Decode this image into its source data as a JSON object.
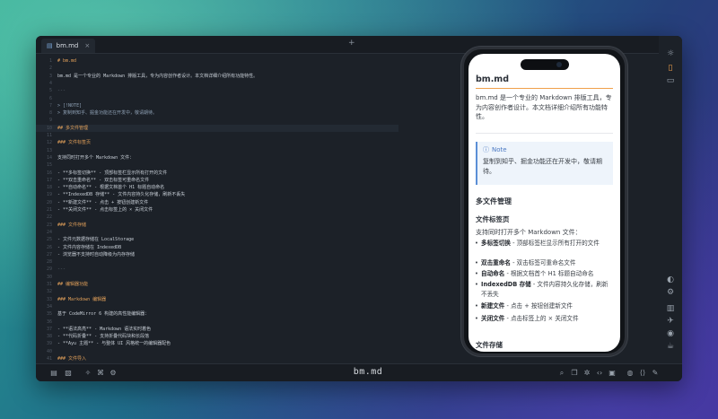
{
  "tab": {
    "filename": "bm.md",
    "close": "×",
    "add": "+"
  },
  "brand": "bm.md",
  "editor_lines": [
    {
      "n": "1",
      "t": "# bm.md",
      "k": "h"
    },
    {
      "n": "2",
      "t": "",
      "k": ""
    },
    {
      "n": "3",
      "t": "bm.md 是一个专业的 Markdown 排版工具，专为内容创作者设计。本文档详细介绍所有功能特性。",
      "k": "b"
    },
    {
      "n": "4",
      "t": "",
      "k": ""
    },
    {
      "n": "5",
      "t": "---",
      "k": "dim"
    },
    {
      "n": "6",
      "t": "",
      "k": ""
    },
    {
      "n": "7",
      "t": "> [!NOTE]",
      "k": "q"
    },
    {
      "n": "8",
      "t": "> 复制到知乎、掘金功能还在开发中，敬请期待。",
      "k": "q"
    },
    {
      "n": "9",
      "t": "",
      "k": ""
    },
    {
      "n": "10",
      "t": "## 多文件管理",
      "k": "h",
      "cur": true
    },
    {
      "n": "11",
      "t": "",
      "k": ""
    },
    {
      "n": "12",
      "t": "### 文件标签页",
      "k": "h"
    },
    {
      "n": "13",
      "t": "",
      "k": ""
    },
    {
      "n": "14",
      "t": "支持同时打开多个 Markdown 文件：",
      "k": "b"
    },
    {
      "n": "15",
      "t": "",
      "k": ""
    },
    {
      "n": "16",
      "t": "- **多标签切换** - 顶部标签栏显示所有打开的文件",
      "k": "b"
    },
    {
      "n": "17",
      "t": "- **双击重命名** - 双击标签可重命名文件",
      "k": "b"
    },
    {
      "n": "18",
      "t": "- **自动命名** - 根据文档首个 H1 标题自动命名",
      "k": "b"
    },
    {
      "n": "19",
      "t": "- **IndexedDB 存储** - 文件内容持久化存储，刷新不丢失",
      "k": "b"
    },
    {
      "n": "20",
      "t": "- **新建文件** - 点击 + 按钮创建新文件",
      "k": "b"
    },
    {
      "n": "21",
      "t": "- **关闭文件** - 点击标签上的 × 关闭文件",
      "k": "b"
    },
    {
      "n": "22",
      "t": "",
      "k": ""
    },
    {
      "n": "23",
      "t": "### 文件存储",
      "k": "h"
    },
    {
      "n": "24",
      "t": "",
      "k": ""
    },
    {
      "n": "25",
      "t": "- 文件元数据存储在 LocalStorage",
      "k": "b"
    },
    {
      "n": "26",
      "t": "- 文件内容存储在 IndexedDB",
      "k": "b"
    },
    {
      "n": "27",
      "t": "- 浏览器不支持时自动降级为内存存储",
      "k": "b"
    },
    {
      "n": "28",
      "t": "",
      "k": ""
    },
    {
      "n": "29",
      "t": "---",
      "k": "dim"
    },
    {
      "n": "30",
      "t": "",
      "k": ""
    },
    {
      "n": "31",
      "t": "## 编辑器功能",
      "k": "h"
    },
    {
      "n": "32",
      "t": "",
      "k": ""
    },
    {
      "n": "33",
      "t": "### Markdown 编辑器",
      "k": "h"
    },
    {
      "n": "34",
      "t": "",
      "k": ""
    },
    {
      "n": "35",
      "t": "基于 CodeMirror 6 构建的高性能编辑器：",
      "k": "b"
    },
    {
      "n": "36",
      "t": "",
      "k": ""
    },
    {
      "n": "37",
      "t": "- **语法高亮** - Markdown 语法实时着色",
      "k": "b"
    },
    {
      "n": "38",
      "t": "- **代码折叠** - 支持折叠代码块和长段落",
      "k": "b"
    },
    {
      "n": "39",
      "t": "- **Ayu 主题** - 与整体 UI 风格统一的编辑器配色",
      "k": "b"
    },
    {
      "n": "40",
      "t": "",
      "k": ""
    },
    {
      "n": "41",
      "t": "### 文件导入",
      "k": "h"
    }
  ],
  "preview": {
    "title": "bm.md",
    "intro": "bm.md 是一个专业的 Markdown 排版工具，专为内容创作者设计。本文档详细介绍所有功能特性。",
    "note_label": "Note",
    "note_body": "复制到知乎、掘金功能还在开发中，敬请期待。",
    "h2": "多文件管理",
    "h3": "文件标签页",
    "lead": "支持同时打开多个 Markdown 文件：",
    "items": [
      {
        "b": "多标签切换",
        "t": " - 顶部标签栏显示所有打开的文件"
      },
      {
        "b": "双击重命名",
        "t": " - 双击标签可重命名文件"
      },
      {
        "b": "自动命名",
        "t": " - 根据文档首个 H1 标题自动命名"
      },
      {
        "b": "IndexedDB 存储",
        "t": " - 文件内容持久化存储，刷新不丢失"
      },
      {
        "b": "新建文件",
        "t": " - 点击 + 按钮创建新文件"
      },
      {
        "b": "关闭文件",
        "t": " - 点击标签上的 × 关闭文件"
      }
    ],
    "h3b": "文件存储"
  },
  "icons": {
    "side": [
      "sun-icon",
      "phone-icon",
      "monitor-icon",
      "palette-icon",
      "gear-icon",
      "book-icon",
      "twitter-icon",
      "github-icon",
      "coffee-icon"
    ],
    "bottom_left": [
      "file-icon",
      "file-export-icon",
      "magic-wand-icon",
      "command-icon",
      "settings-icon"
    ],
    "bottom_right": [
      "zoom-icon",
      "copy-icon",
      "wechat-icon",
      "code-icon",
      "image-icon",
      "theme-icon",
      "code-brackets-icon",
      "pen-icon"
    ]
  },
  "colors": {
    "accent": "#f0a04b",
    "note": "#5b8fd6",
    "editor_bg": "#1c2128"
  }
}
